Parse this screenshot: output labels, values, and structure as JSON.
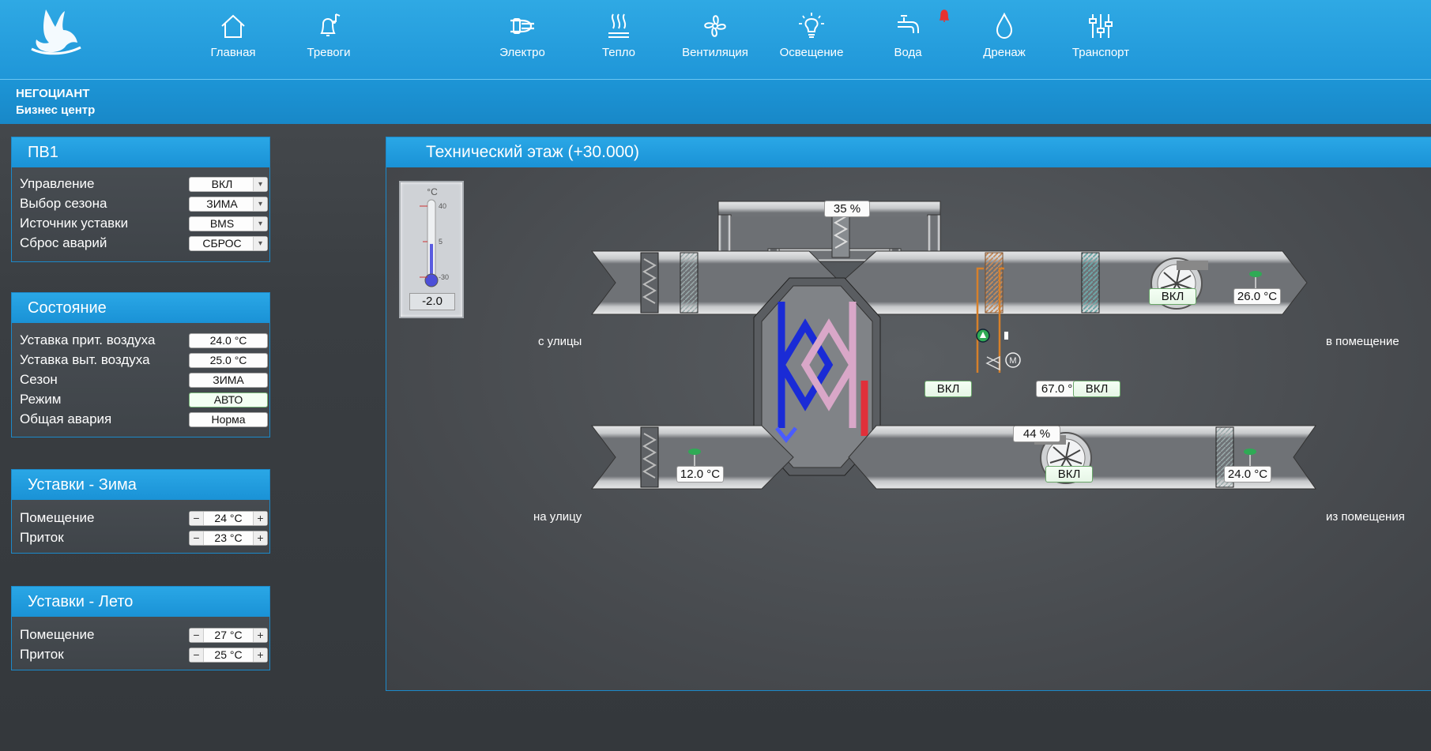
{
  "nav": {
    "items": [
      {
        "label": "Главная",
        "icon": "home-icon"
      },
      {
        "label": "Тревоги",
        "icon": "bell-icon"
      },
      {
        "label": "Электро",
        "icon": "plug-icon"
      },
      {
        "label": "Тепло",
        "icon": "heat-icon"
      },
      {
        "label": "Вентиляция",
        "icon": "fan-icon"
      },
      {
        "label": "Освещение",
        "icon": "lightbulb-icon"
      },
      {
        "label": "Вода",
        "icon": "faucet-icon"
      },
      {
        "label": "Дренаж",
        "icon": "drop-icon"
      },
      {
        "label": "Транспорт",
        "icon": "sliders-icon"
      }
    ],
    "alarm_color": "#e8322f"
  },
  "org": {
    "name": "НЕГОЦИАНТ",
    "subtitle": "Бизнес центр"
  },
  "panels": {
    "pv1": {
      "title": "ПВ1",
      "rows": [
        {
          "label": "Управление",
          "value": "ВКЛ"
        },
        {
          "label": "Выбор сезона",
          "value": "ЗИМА"
        },
        {
          "label": "Источник уставки",
          "value": "BMS"
        },
        {
          "label": "Сброс аварий",
          "value": "СБРОС"
        }
      ]
    },
    "state": {
      "title": "Состояние",
      "rows": [
        {
          "label": "Уставка прит. воздуха",
          "value": "24.0 °C"
        },
        {
          "label": "Уставка выт. воздуха",
          "value": "25.0 °C"
        },
        {
          "label": "Сезон",
          "value": "ЗИМА"
        },
        {
          "label": "Режим",
          "value": "АВТО"
        },
        {
          "label": "Общая авария",
          "value": "Норма"
        }
      ]
    },
    "winter": {
      "title": "Уставки - Зима",
      "rows": [
        {
          "label": "Помещение",
          "value": "24 °C"
        },
        {
          "label": "Приток",
          "value": "23 °C"
        }
      ]
    },
    "summer": {
      "title": "Уставки - Лето",
      "rows": [
        {
          "label": "Помещение",
          "value": "27 °C"
        },
        {
          "label": "Приток",
          "value": "25 °C"
        }
      ]
    }
  },
  "stepper": {
    "minus": "−",
    "plus": "+"
  },
  "dropdown_glyph": "▾",
  "diagram": {
    "title": "Технический этаж (+30.000)",
    "thermometer": {
      "unit": "°C",
      "ticks": [
        "40",
        "5",
        "-30"
      ],
      "value": "-2.0",
      "level_fraction": 0.45
    },
    "labels": {
      "outdoor_in": "с улицы",
      "room_out": "в помещение",
      "outdoor_out": "на улицу",
      "room_in": "из помещения"
    },
    "bypass_damper": "35 %",
    "supply_fan_state": "ВКЛ",
    "supply_temp": "26.0 °C",
    "pump_state": "ВКЛ",
    "water_temp": "67.0 °C",
    "heater_state": "ВКЛ",
    "valve_position": "44 %",
    "valve_motor": "M",
    "exhaust_temp": "12.0 °C",
    "exhaust_fan_state": "ВКЛ",
    "return_temp": "24.0 °C"
  },
  "colors": {
    "accent": "#1f96d8",
    "cold": "#1a2bd6",
    "hot": "#e0303a",
    "ok_green": "#2faa55"
  }
}
